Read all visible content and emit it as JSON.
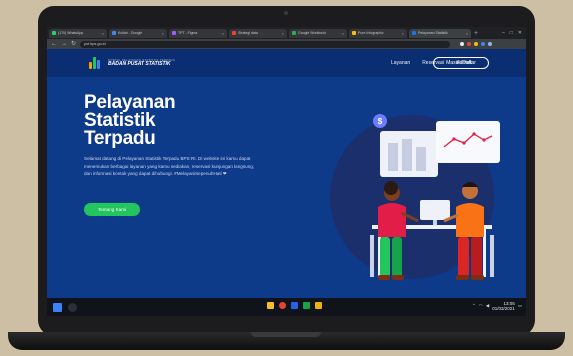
{
  "browser": {
    "tabs": [
      {
        "label": "(170) WhatsApp",
        "color": "#25d366",
        "active": false
      },
      {
        "label": "Kuliah - Google",
        "color": "#4285f4",
        "active": false
      },
      {
        "label": "TPT - Figma",
        "color": "#a259ff",
        "active": false
      },
      {
        "label": "Strategi data",
        "color": "#ea4335",
        "active": false
      },
      {
        "label": "Google Workbook",
        "color": "#34a853",
        "active": false
      },
      {
        "label": "Pure Infographic",
        "color": "#fbbc05",
        "active": false
      },
      {
        "label": "Pelayanan Statistik",
        "color": "#1a73e8",
        "active": true
      }
    ],
    "url": "pst.bps.go.id"
  },
  "site": {
    "logo_sub": "PORTAL PELAYANAN STATISTIK TERPADU",
    "logo_title": "BADAN PUSAT STATISTIK",
    "nav": [
      "Layanan",
      "Reservasi",
      "Kontak"
    ],
    "login_label": "Masuk/Daftar"
  },
  "hero": {
    "title_lines": [
      "Pelayanan",
      "Statistik",
      "Terpadu"
    ],
    "description": "Selamat datang di Pelayanan Statistik Terpadu BPS RI. Di website ini kamu dapat menemukan berbagai layanan yang kamu sediakan, reservasi kunjungan langsung, dan informasi kontak yang dapat dihubungi. #MelayaniSepenuhHati ❤",
    "cta_label": "Tentang Kami"
  },
  "taskbar": {
    "time": "13:05",
    "date": "01/03/2021"
  },
  "colors": {
    "hero_bg": "#0e3a8a",
    "header_bg": "#0b2e73",
    "cta": "#22c55e",
    "accent_red": "#e11d48",
    "accent_orange": "#f97316"
  }
}
